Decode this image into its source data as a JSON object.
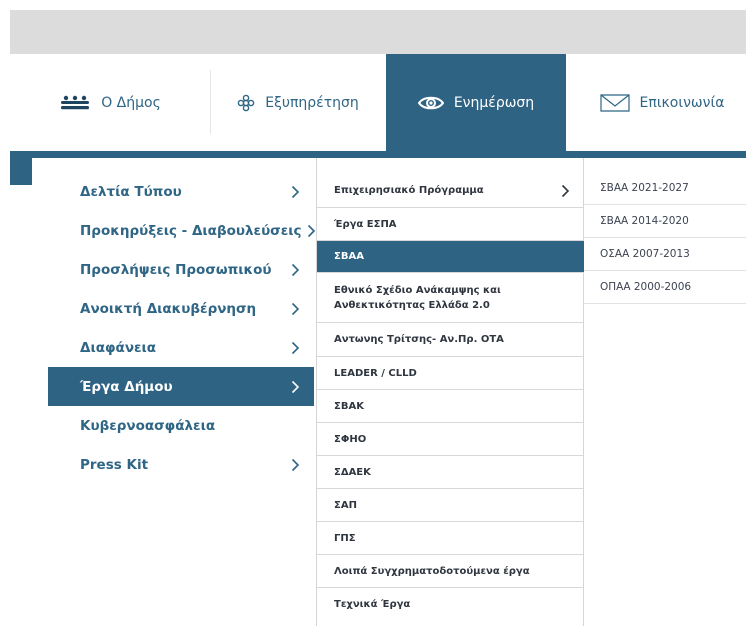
{
  "nav": {
    "items": [
      {
        "label": "Ο Δήμος",
        "icon": "people-group-icon"
      },
      {
        "label": "Εξυπηρέτηση",
        "icon": "gear-flower-icon"
      },
      {
        "label": "Ενημέρωση",
        "icon": "eye-icon"
      },
      {
        "label": "Επικοινωνία",
        "icon": "envelope-icon"
      }
    ],
    "active_index": 2
  },
  "menu": {
    "column1": [
      {
        "label": "Δελτία Τύπου",
        "has_submenu": true
      },
      {
        "label": "Προκηρύξεις - Διαβουλεύσεις",
        "has_submenu": true
      },
      {
        "label": "Προσλήψεις Προσωπικού",
        "has_submenu": true
      },
      {
        "label": "Ανοικτή Διακυβέρνηση",
        "has_submenu": true
      },
      {
        "label": "Διαφάνεια",
        "has_submenu": true
      },
      {
        "label": "Έργα Δήμου",
        "has_submenu": true,
        "active": true
      },
      {
        "label": "Κυβερνοασφάλεια",
        "has_submenu": false
      },
      {
        "label": "Press Kit",
        "has_submenu": true
      }
    ],
    "column2": [
      {
        "label": "Επιχειρησιακό Πρόγραμμα",
        "has_submenu": true
      },
      {
        "label": "Έργα ΕΣΠΑ"
      },
      {
        "label": "ΣΒΑΑ",
        "active": true
      },
      {
        "label": "Εθνικό Σχέδιο Ανάκαμψης και Ανθεκτικότητας Ελλάδα 2.0"
      },
      {
        "label": "Αντωνης Τρίτσης- Αν.Πρ. ΟΤΑ"
      },
      {
        "label": "LEADER / CLLD"
      },
      {
        "label": "ΣΒΑΚ"
      },
      {
        "label": "ΣΦΗΟ"
      },
      {
        "label": "ΣΔΑΕΚ"
      },
      {
        "label": "ΣΑΠ"
      },
      {
        "label": "ΓΠΣ"
      },
      {
        "label": "Λοιπά Συγχρηματοδοτούμενα έργα"
      },
      {
        "label": "Τεχνικά Έργα"
      }
    ],
    "column3": [
      {
        "label": "ΣΒΑΑ 2021-2027"
      },
      {
        "label": "ΣΒΑΑ 2014-2020"
      },
      {
        "label": "ΟΣΑΑ 2007-2013"
      },
      {
        "label": "ΟΠΑΑ 2000-2006"
      }
    ]
  },
  "colors": {
    "brand_blue": "#2e6384",
    "link_blue": "#2f6585",
    "top_bar_gray": "#dcdcdc"
  }
}
